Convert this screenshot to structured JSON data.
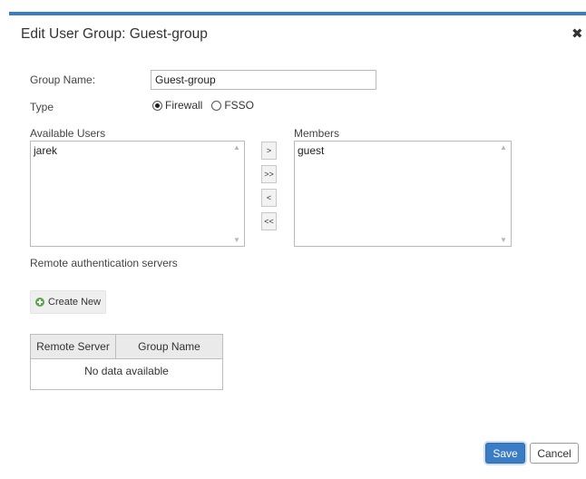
{
  "dialog": {
    "title": "Edit User Group: Guest-group",
    "close_icon": "close-icon",
    "accent_color": "#3b7dc4"
  },
  "form": {
    "group_name_label": "Group Name:",
    "group_name_value": "Guest-group",
    "type_label": "Type",
    "type_options": [
      "Firewall",
      "FSSO"
    ],
    "type_selected": "Firewall",
    "available_users_label": "Available Users",
    "available_users": [
      "jarek"
    ],
    "members_label": "Members",
    "members": [
      "guest"
    ],
    "move_buttons": {
      "add": ">",
      "add_all": ">>",
      "remove": "<",
      "remove_all": "<<"
    },
    "remote_auth_label": "Remote authentication servers",
    "create_new_label": "Create New",
    "table": {
      "columns": [
        "Remote Server",
        "Group Name"
      ],
      "rows": [],
      "empty_text": "No data available"
    }
  },
  "footer": {
    "save_label": "Save",
    "cancel_label": "Cancel"
  }
}
